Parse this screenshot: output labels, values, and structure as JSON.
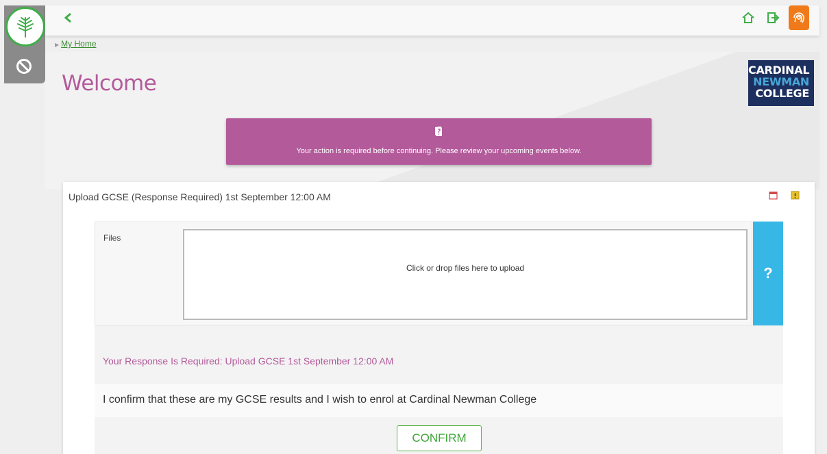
{
  "nav": {
    "back_icon": "chevron-left-icon",
    "home_icon": "home-icon",
    "logout_icon": "logout-icon",
    "profile_icon": "fingerprint-icon"
  },
  "breadcrumb": {
    "items": [
      {
        "label": "My Home"
      }
    ]
  },
  "page": {
    "title": "Welcome"
  },
  "college_logo": {
    "line1": "CARDINAL",
    "line2": "NEWMAN",
    "line3": "COLLEGE"
  },
  "alert": {
    "message": "Your action is required before continuing. Please review your upcoming events below."
  },
  "event": {
    "title": "Upload GCSE (Response Required) 1st September 12:00 AM",
    "files_label": "Files",
    "dropzone_text": "Click or drop files here to upload",
    "help_label": "?",
    "response_title": "Your Response Is Required: Upload GCSE 1st September 12:00 AM",
    "confirm_statement": "I confirm that these are my GCSE results and I wish to enrol at Cardinal Newman College",
    "confirm_button": "CONFIRM"
  },
  "colors": {
    "accent_purple": "#b35a9b",
    "accent_green": "#3fae49",
    "help_blue": "#37b7e6",
    "brand_navy": "#1d2f5e",
    "profile_orange": "#f07a1a"
  }
}
